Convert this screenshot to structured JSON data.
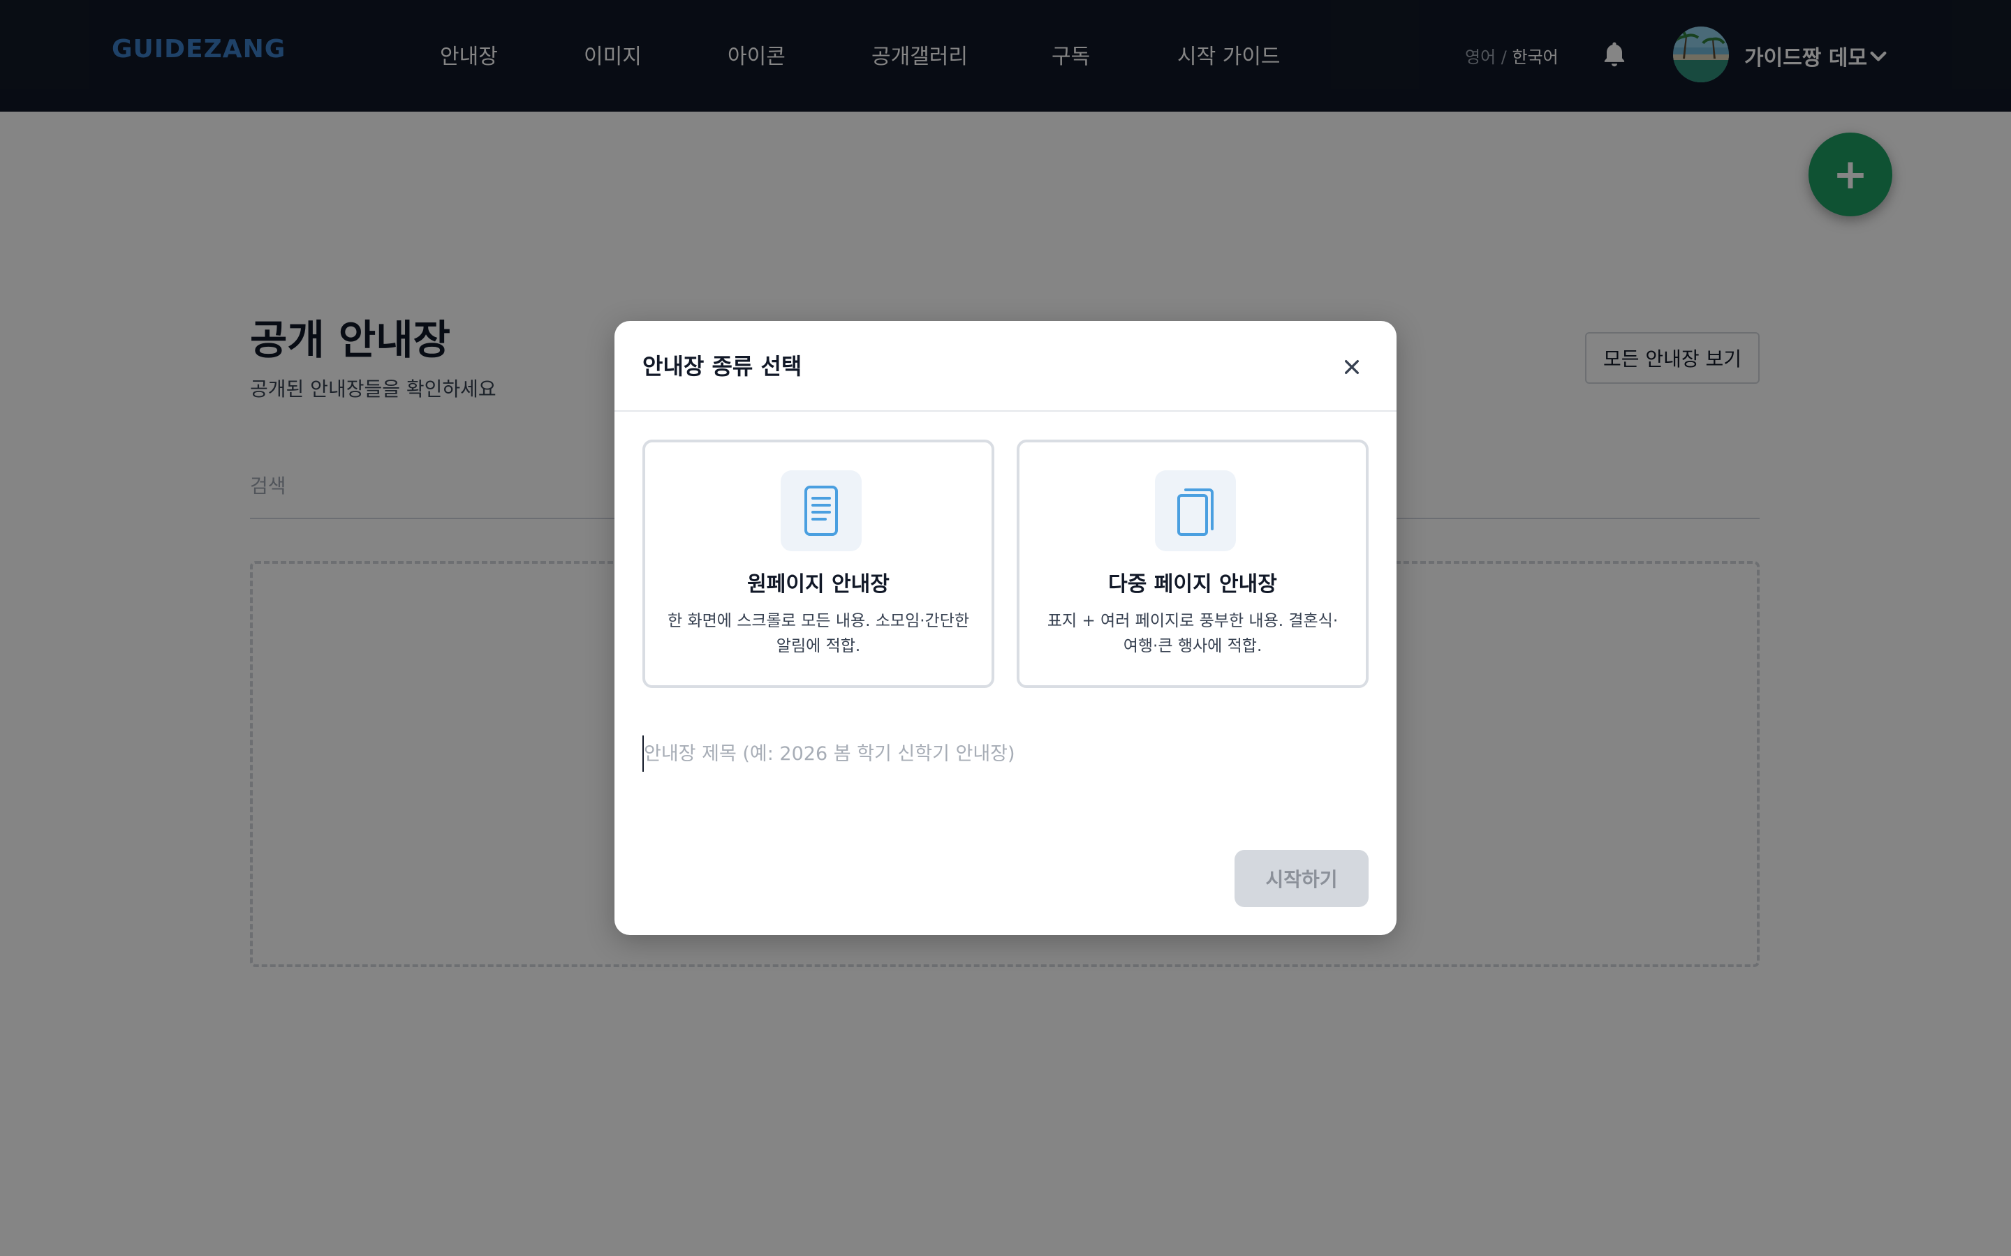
{
  "colors": {
    "nav_bg": "#111827",
    "logo": "#3d7fc7",
    "fab": "#1e9e63",
    "icon_blue": "#4a9fe0",
    "disabled_btn": "#d4d8de"
  },
  "header": {
    "logo": "GUIDEZANG",
    "nav": [
      "안내장",
      "이미지",
      "아이콘",
      "공개갤러리",
      "구독",
      "시작 가이드"
    ],
    "lang_inactive": "영어",
    "lang_separator": " / ",
    "lang_active": "한국어",
    "bell_icon": "bell-icon",
    "user_name": "가이드짱 데모",
    "dropdown_icon": "chevron-down-icon"
  },
  "fab": {
    "label": "+"
  },
  "page": {
    "title": "공개 안내장",
    "subtitle": "공개된 안내장들을 확인하세요",
    "all_button": "모든 안내장 보기",
    "search_placeholder": "검색"
  },
  "modal": {
    "title": "안내장 종류 선택",
    "close_icon": "close-icon",
    "cards": [
      {
        "icon": "single-page-document-icon",
        "title": "원페이지 안내장",
        "desc": "한 화면에 스크롤로 모든 내용. 소모임·간단한 알림에 적합."
      },
      {
        "icon": "multi-page-document-icon",
        "title": "다중 페이지 안내장",
        "desc": "표지 + 여러 페이지로 풍부한 내용. 결혼식·여행·큰 행사에 적합."
      }
    ],
    "title_input_placeholder": "안내장 제목 (예: 2026 봄 학기 신학기 안내장)",
    "title_input_value": "",
    "start_button": "시작하기"
  }
}
